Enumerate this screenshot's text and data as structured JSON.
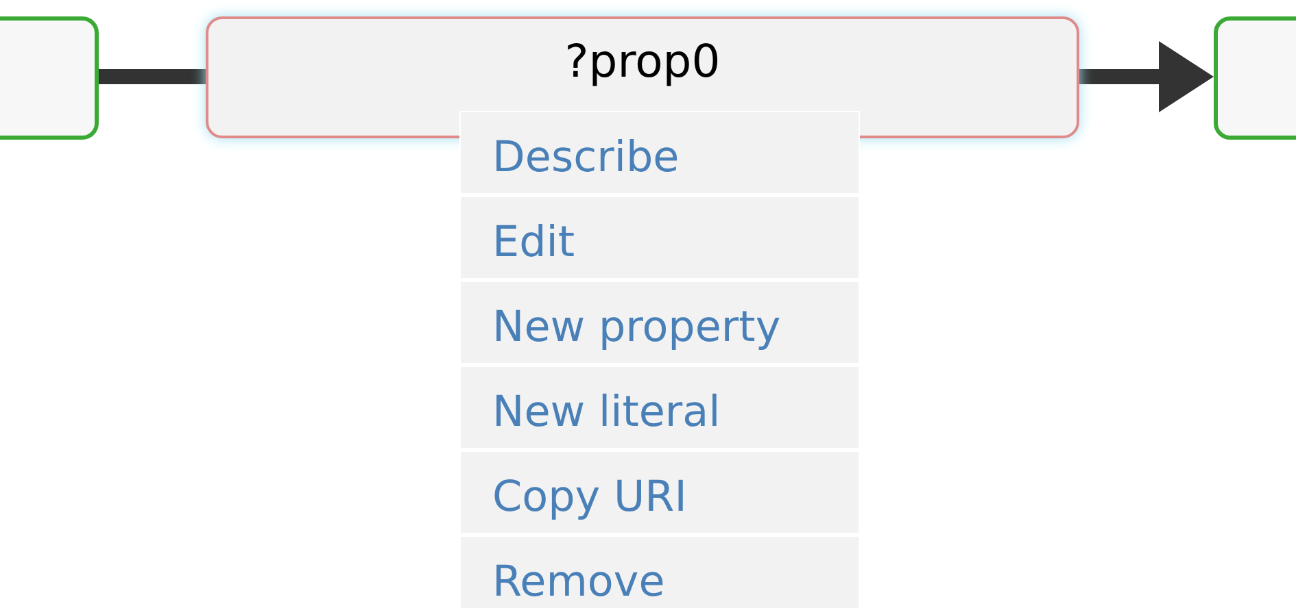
{
  "nodes": [
    {
      "selected": false
    },
    {
      "label": "?prop0",
      "selected": true
    },
    {
      "selected": false
    }
  ],
  "context_menu": {
    "items": [
      "Describe",
      "Edit",
      "New property",
      "New literal",
      "Copy URI",
      "Remove"
    ]
  }
}
